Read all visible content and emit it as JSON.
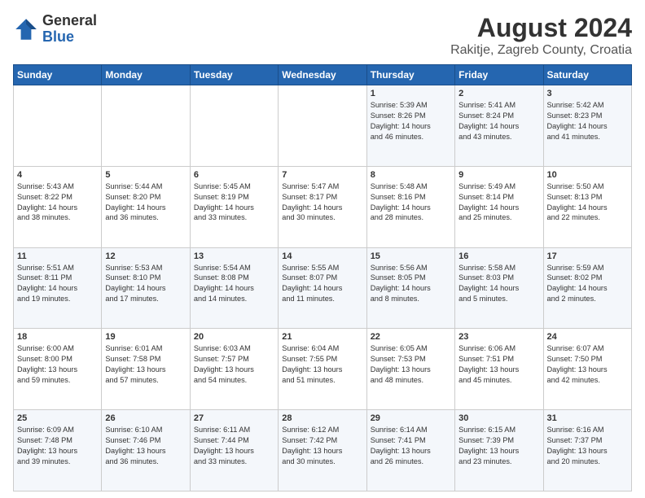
{
  "header": {
    "logo": {
      "general": "General",
      "blue": "Blue"
    },
    "title": "August 2024",
    "subtitle": "Rakitje, Zagreb County, Croatia"
  },
  "weekdays": [
    "Sunday",
    "Monday",
    "Tuesday",
    "Wednesday",
    "Thursday",
    "Friday",
    "Saturday"
  ],
  "weeks": [
    [
      {
        "day": "",
        "content": ""
      },
      {
        "day": "",
        "content": ""
      },
      {
        "day": "",
        "content": ""
      },
      {
        "day": "",
        "content": ""
      },
      {
        "day": "1",
        "content": "Sunrise: 5:39 AM\nSunset: 8:26 PM\nDaylight: 14 hours\nand 46 minutes."
      },
      {
        "day": "2",
        "content": "Sunrise: 5:41 AM\nSunset: 8:24 PM\nDaylight: 14 hours\nand 43 minutes."
      },
      {
        "day": "3",
        "content": "Sunrise: 5:42 AM\nSunset: 8:23 PM\nDaylight: 14 hours\nand 41 minutes."
      }
    ],
    [
      {
        "day": "4",
        "content": "Sunrise: 5:43 AM\nSunset: 8:22 PM\nDaylight: 14 hours\nand 38 minutes."
      },
      {
        "day": "5",
        "content": "Sunrise: 5:44 AM\nSunset: 8:20 PM\nDaylight: 14 hours\nand 36 minutes."
      },
      {
        "day": "6",
        "content": "Sunrise: 5:45 AM\nSunset: 8:19 PM\nDaylight: 14 hours\nand 33 minutes."
      },
      {
        "day": "7",
        "content": "Sunrise: 5:47 AM\nSunset: 8:17 PM\nDaylight: 14 hours\nand 30 minutes."
      },
      {
        "day": "8",
        "content": "Sunrise: 5:48 AM\nSunset: 8:16 PM\nDaylight: 14 hours\nand 28 minutes."
      },
      {
        "day": "9",
        "content": "Sunrise: 5:49 AM\nSunset: 8:14 PM\nDaylight: 14 hours\nand 25 minutes."
      },
      {
        "day": "10",
        "content": "Sunrise: 5:50 AM\nSunset: 8:13 PM\nDaylight: 14 hours\nand 22 minutes."
      }
    ],
    [
      {
        "day": "11",
        "content": "Sunrise: 5:51 AM\nSunset: 8:11 PM\nDaylight: 14 hours\nand 19 minutes."
      },
      {
        "day": "12",
        "content": "Sunrise: 5:53 AM\nSunset: 8:10 PM\nDaylight: 14 hours\nand 17 minutes."
      },
      {
        "day": "13",
        "content": "Sunrise: 5:54 AM\nSunset: 8:08 PM\nDaylight: 14 hours\nand 14 minutes."
      },
      {
        "day": "14",
        "content": "Sunrise: 5:55 AM\nSunset: 8:07 PM\nDaylight: 14 hours\nand 11 minutes."
      },
      {
        "day": "15",
        "content": "Sunrise: 5:56 AM\nSunset: 8:05 PM\nDaylight: 14 hours\nand 8 minutes."
      },
      {
        "day": "16",
        "content": "Sunrise: 5:58 AM\nSunset: 8:03 PM\nDaylight: 14 hours\nand 5 minutes."
      },
      {
        "day": "17",
        "content": "Sunrise: 5:59 AM\nSunset: 8:02 PM\nDaylight: 14 hours\nand 2 minutes."
      }
    ],
    [
      {
        "day": "18",
        "content": "Sunrise: 6:00 AM\nSunset: 8:00 PM\nDaylight: 13 hours\nand 59 minutes."
      },
      {
        "day": "19",
        "content": "Sunrise: 6:01 AM\nSunset: 7:58 PM\nDaylight: 13 hours\nand 57 minutes."
      },
      {
        "day": "20",
        "content": "Sunrise: 6:03 AM\nSunset: 7:57 PM\nDaylight: 13 hours\nand 54 minutes."
      },
      {
        "day": "21",
        "content": "Sunrise: 6:04 AM\nSunset: 7:55 PM\nDaylight: 13 hours\nand 51 minutes."
      },
      {
        "day": "22",
        "content": "Sunrise: 6:05 AM\nSunset: 7:53 PM\nDaylight: 13 hours\nand 48 minutes."
      },
      {
        "day": "23",
        "content": "Sunrise: 6:06 AM\nSunset: 7:51 PM\nDaylight: 13 hours\nand 45 minutes."
      },
      {
        "day": "24",
        "content": "Sunrise: 6:07 AM\nSunset: 7:50 PM\nDaylight: 13 hours\nand 42 minutes."
      }
    ],
    [
      {
        "day": "25",
        "content": "Sunrise: 6:09 AM\nSunset: 7:48 PM\nDaylight: 13 hours\nand 39 minutes."
      },
      {
        "day": "26",
        "content": "Sunrise: 6:10 AM\nSunset: 7:46 PM\nDaylight: 13 hours\nand 36 minutes."
      },
      {
        "day": "27",
        "content": "Sunrise: 6:11 AM\nSunset: 7:44 PM\nDaylight: 13 hours\nand 33 minutes."
      },
      {
        "day": "28",
        "content": "Sunrise: 6:12 AM\nSunset: 7:42 PM\nDaylight: 13 hours\nand 30 minutes."
      },
      {
        "day": "29",
        "content": "Sunrise: 6:14 AM\nSunset: 7:41 PM\nDaylight: 13 hours\nand 26 minutes."
      },
      {
        "day": "30",
        "content": "Sunrise: 6:15 AM\nSunset: 7:39 PM\nDaylight: 13 hours\nand 23 minutes."
      },
      {
        "day": "31",
        "content": "Sunrise: 6:16 AM\nSunset: 7:37 PM\nDaylight: 13 hours\nand 20 minutes."
      }
    ]
  ]
}
